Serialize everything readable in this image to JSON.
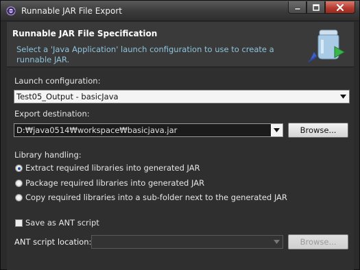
{
  "window": {
    "title": "Runnable JAR File Export"
  },
  "banner": {
    "title": "Runnable JAR File Specification",
    "description": "Select a 'Java Application' launch configuration to use to create a runnable JAR."
  },
  "launch": {
    "label": "Launch configuration:",
    "selected": "Test05_Output - basicJava"
  },
  "export": {
    "label": "Export destination:",
    "value": "D:₩java0514₩workspace₩basicjava.jar",
    "browse_label": "Browse..."
  },
  "library": {
    "label": "Library handling:",
    "options": [
      {
        "label": "Extract required libraries into generated JAR",
        "checked": true
      },
      {
        "label": "Package required libraries into generated JAR",
        "checked": false
      },
      {
        "label": "Copy required libraries into a sub-folder next to the generated JAR",
        "checked": false
      }
    ]
  },
  "ant": {
    "save_label": "Save as ANT script",
    "location_label": "ANT script location:",
    "location_value": "",
    "browse_label": "Browse..."
  },
  "colors": {
    "banner_desc": "#8fc4dc",
    "radio_selected": "#1e4e9a",
    "close_button": "#b23a2c"
  }
}
